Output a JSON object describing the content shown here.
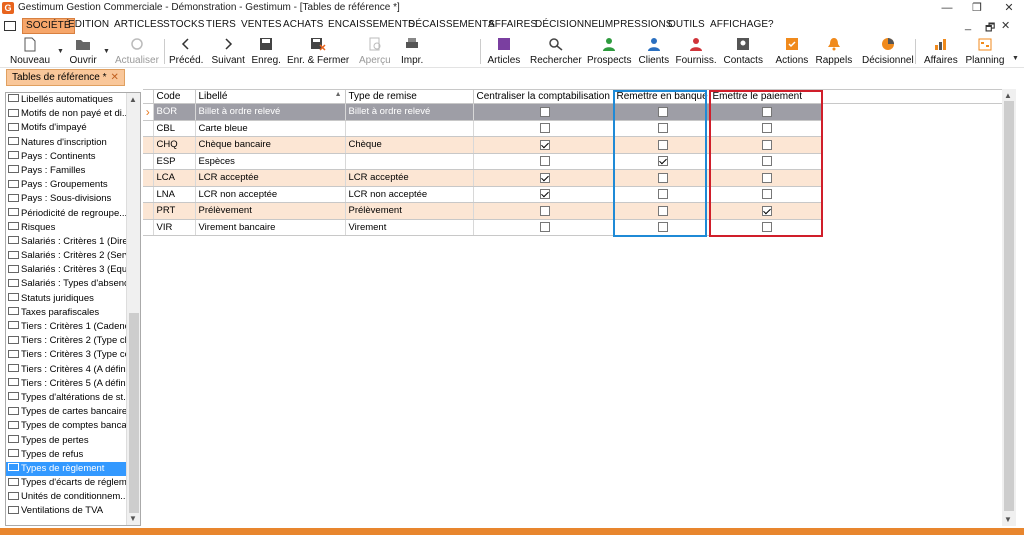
{
  "window": {
    "title": "Gestimum Gestion Commerciale - Démonstration - Gestimum - [Tables de référence *]",
    "app_icon": "G",
    "controls": [
      "—",
      "❐",
      "✕"
    ]
  },
  "menu": {
    "items": [
      "SOCIÉTÉ",
      "EDITION",
      "ARTICLES",
      "STOCKS",
      "TIERS",
      "VENTES",
      "ACHATS",
      "ENCAISSEMENTS",
      "DÉCAISSEMENTS",
      "AFFAIRES",
      "DÉCISIONNEL",
      "IMPRESSIONS",
      "OUTILS",
      "AFFICHAGE",
      "?"
    ],
    "active_index": 0,
    "mdi_controls": [
      "_",
      "🗗",
      "✕"
    ]
  },
  "toolbar": {
    "buttons": [
      {
        "label": "Nouveau",
        "icon": "new-document-icon",
        "disabled": false
      },
      {
        "label": "Ouvrir",
        "icon": "open-folder-icon",
        "disabled": false
      },
      {
        "label": "Actualiser",
        "icon": "refresh-icon",
        "disabled": true
      },
      {
        "label": "Précéd.",
        "icon": "chevron-left-icon",
        "disabled": false
      },
      {
        "label": "Suivant",
        "icon": "chevron-right-icon",
        "disabled": false
      },
      {
        "label": "Enreg.",
        "icon": "save-icon",
        "disabled": false
      },
      {
        "label": "Enr. & Fermer",
        "icon": "save-close-icon",
        "disabled": false
      },
      {
        "label": "Aperçu",
        "icon": "preview-icon",
        "disabled": true
      },
      {
        "label": "Impr.",
        "icon": "print-icon",
        "disabled": false
      },
      {
        "label": "Articles",
        "icon": "articles-icon",
        "disabled": false
      },
      {
        "label": "Rechercher",
        "icon": "search-icon",
        "disabled": false
      },
      {
        "label": "Prospects",
        "icon": "prospects-icon",
        "disabled": false
      },
      {
        "label": "Clients",
        "icon": "clients-icon",
        "disabled": false
      },
      {
        "label": "Fourniss.",
        "icon": "suppliers-icon",
        "disabled": false
      },
      {
        "label": "Contacts",
        "icon": "contacts-icon",
        "disabled": false
      },
      {
        "label": "Actions",
        "icon": "actions-icon",
        "disabled": false
      },
      {
        "label": "Rappels",
        "icon": "bell-icon",
        "disabled": false
      },
      {
        "label": "Décisionnel",
        "icon": "pie-chart-icon",
        "disabled": false
      },
      {
        "label": "Affaires",
        "icon": "bar-chart-icon",
        "disabled": false
      },
      {
        "label": "Planning",
        "icon": "planning-icon",
        "disabled": false
      }
    ]
  },
  "tab": {
    "label": "Tables de référence *",
    "close": "✕"
  },
  "left_panel": {
    "items": [
      "Libellés automatiques",
      "Motifs de non payé et di...",
      "Motifs d'impayé",
      "Natures d'inscription",
      "Pays : Continents",
      "Pays : Familles",
      "Pays : Groupements",
      "Pays : Sous-divisions",
      "Périodicité de regroupe...",
      "Risques",
      "Salariés : Critères 1 (Direc...",
      "Salariés : Critères 2 (Servi...",
      "Salariés : Critères 3 (Equi...",
      "Salariés : Types d'absence",
      "Statuts juridiques",
      "Taxes parafiscales",
      "Tiers : Critères 1 (Cadence)",
      "Tiers : Critères 2 (Type cli...",
      "Tiers : Critères 3 (Type ce...",
      "Tiers : Critères 4 (A définir)",
      "Tiers : Critères 5 (A définir)",
      "Types d'altérations de st...",
      "Types de cartes bancaires",
      "Types de comptes banca...",
      "Types de pertes",
      "Types de refus",
      "Types de règlement",
      "Types d'écarts de réglem...",
      "Unités de conditionnem...",
      "Ventilations de TVA"
    ],
    "selected_index": 26
  },
  "grid": {
    "columns": [
      "Code",
      "Libellé",
      "Type de remise",
      "Centraliser la comptabilisation",
      "Remettre en banque",
      "Emettre le paiement"
    ],
    "rows": [
      {
        "code": "BOR",
        "libelle": "Billet à ordre relevé",
        "type_remise": "Billet à ordre relevé",
        "centraliser": false,
        "remettre": false,
        "emettre": false,
        "selected": true
      },
      {
        "code": "CBL",
        "libelle": "Carte bleue",
        "type_remise": "",
        "centraliser": false,
        "remettre": false,
        "emettre": false
      },
      {
        "code": "CHQ",
        "libelle": "Chèque bancaire",
        "type_remise": "Chèque",
        "centraliser": true,
        "remettre": false,
        "emettre": false
      },
      {
        "code": "ESP",
        "libelle": "Espèces",
        "type_remise": "",
        "centraliser": false,
        "remettre": true,
        "emettre": false
      },
      {
        "code": "LCA",
        "libelle": "LCR acceptée",
        "type_remise": "LCR acceptée",
        "centraliser": true,
        "remettre": false,
        "emettre": false
      },
      {
        "code": "LNA",
        "libelle": "LCR non acceptée",
        "type_remise": "LCR non acceptée",
        "centraliser": true,
        "remettre": false,
        "emettre": false
      },
      {
        "code": "PRT",
        "libelle": "Prélèvement",
        "type_remise": "Prélèvement",
        "centraliser": false,
        "remettre": false,
        "emettre": true
      },
      {
        "code": "VIR",
        "libelle": "Virement bancaire",
        "type_remise": "Virement",
        "centraliser": false,
        "remettre": false,
        "emettre": false
      }
    ]
  },
  "colors": {
    "accent": "#e8862e",
    "row_alt": "#fce6d4",
    "row_selected": "#9e9ea6",
    "highlight_blue": "#1f8ad6",
    "highlight_red": "#d01e2a",
    "list_selected": "#3399ff"
  }
}
